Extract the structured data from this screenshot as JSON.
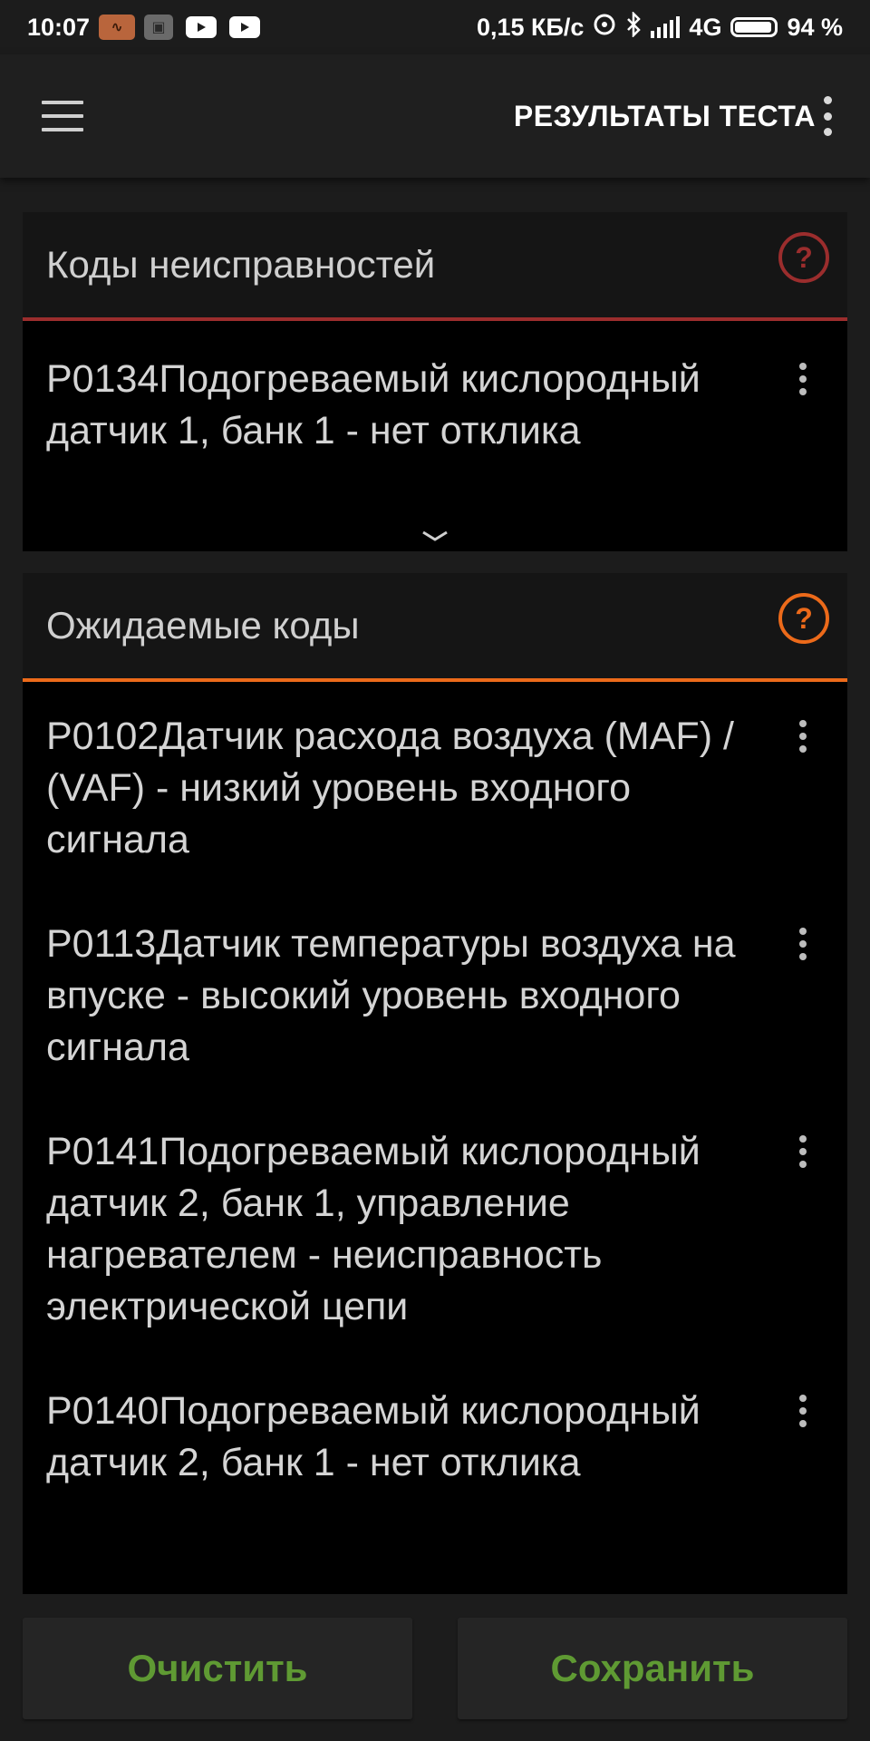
{
  "status_bar": {
    "time": "10:07",
    "network_speed": "0,15 КБ/с",
    "network_type": "4G",
    "battery": "94 %",
    "icons": [
      "car-scanner-app-icon",
      "car-app-icon-2",
      "youtube-icon",
      "youtube-icon",
      "hotspot-icon",
      "bluetooth-icon",
      "signal-icon",
      "battery-icon"
    ]
  },
  "app_bar": {
    "title": "РЕЗУЛЬТАТЫ ТЕСТА"
  },
  "fault_codes": {
    "title": "Коды неисправностей",
    "accent": "#9b2d2d",
    "items": [
      {
        "text": "P0134Подогреваемый кислородный датчик 1, банк 1 - нет отклика"
      }
    ]
  },
  "pending_codes": {
    "title": "Ожидаемые коды",
    "accent": "#ec6a1a",
    "items": [
      {
        "text": "P0102Датчик расхода воздуха (MAF) / (VAF) - низкий уровень входного сигнала"
      },
      {
        "text": "P0113Датчик температуры воздуха на впуске - высокий уровень входного сигнала"
      },
      {
        "text": "P0141Подогреваемый кислородный датчик 2, банк 1, управление нагревателем - неисправность электрической цепи"
      },
      {
        "text": "P0140Подогреваемый кислородный датчик 2, банк 1 - нет отклика"
      }
    ]
  },
  "buttons": {
    "clear": "Очистить",
    "save": "Сохранить",
    "color": "#5f9a33"
  }
}
